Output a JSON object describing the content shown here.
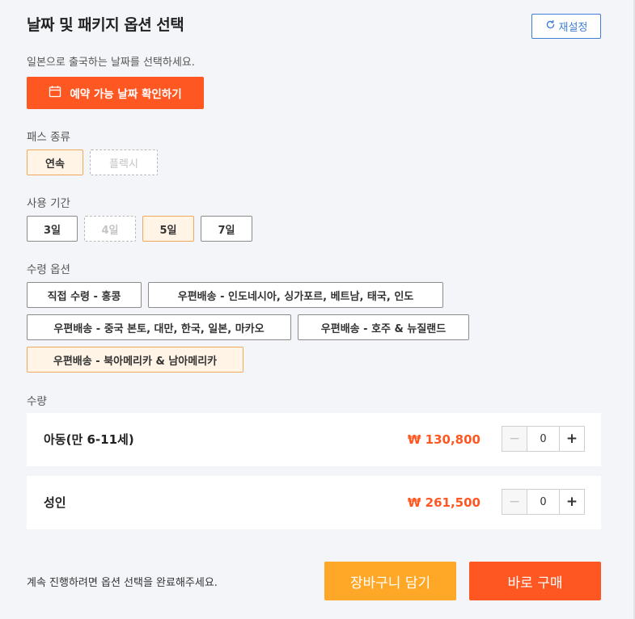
{
  "header": {
    "title": "날짜 및 패키지 옵션 선택",
    "reset_label": "재설정"
  },
  "date": {
    "subtitle": "일본으로 출국하는 날짜를 선택하세요.",
    "check_button_label": "예약 가능 날짜 확인하기"
  },
  "pass_type": {
    "label": "패스 종류",
    "options": [
      {
        "label": "연속",
        "state": "selected"
      },
      {
        "label": "플렉시",
        "state": "disabled"
      }
    ]
  },
  "period": {
    "label": "사용 기간",
    "options": [
      {
        "label": "3일",
        "state": "normal"
      },
      {
        "label": "4일",
        "state": "disabled"
      },
      {
        "label": "5일",
        "state": "selected"
      },
      {
        "label": "7일",
        "state": "normal"
      }
    ]
  },
  "pickup": {
    "label": "수령 옵션",
    "options": [
      {
        "label": "직접 수령 - 홍콩",
        "state": "normal"
      },
      {
        "label": "우편배송 - 인도네시아, 싱가포르, 베트남, 태국, 인도",
        "state": "normal"
      },
      {
        "label": "우편배송 - 중국 본토, 대만, 한국, 일본, 마카오",
        "state": "normal"
      },
      {
        "label": "우편배송 - 호주 & 뉴질랜드",
        "state": "normal"
      },
      {
        "label": "우편배송 - 북아메리카 & 남아메리카",
        "state": "selected"
      }
    ]
  },
  "quantity": {
    "label": "수량",
    "rows": [
      {
        "name": "아동(만 6-11세)",
        "price": "₩ 130,800",
        "value": "0",
        "minus": "−",
        "plus": "+"
      },
      {
        "name": "성인",
        "price": "₩ 261,500",
        "value": "0",
        "minus": "−",
        "plus": "+"
      }
    ]
  },
  "footer": {
    "note": "계속 진행하려면 옵션 선택을 완료해주세요.",
    "cart_label": "장바구니 담기",
    "buy_label": "바로 구매"
  },
  "colors": {
    "accent": "#ff5722",
    "secondary": "#ffa726",
    "link": "#3d7ed6",
    "selected_bg": "#fff4e6"
  },
  "icons": {
    "reset": "refresh-icon",
    "calendar": "calendar-icon"
  }
}
